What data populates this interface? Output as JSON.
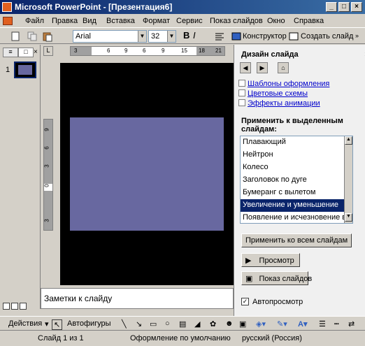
{
  "window": {
    "title": "Microsoft PowerPoint - [Презентация6]"
  },
  "menu": [
    "Файл",
    "Правка",
    "Вид",
    "Вставка",
    "Формат",
    "Сервис",
    "Показ слайдов",
    "Окно",
    "Справка"
  ],
  "toolbar": {
    "font": "Arial",
    "size": "32",
    "constructor": "Конструктор",
    "new_slide": "Создать слайд"
  },
  "outline": {
    "slide_number": "1"
  },
  "ruler": {
    "ticks": [
      "3",
      "6",
      "9",
      "6",
      "9",
      "15",
      "18",
      "21"
    ]
  },
  "vruler": {
    "ticks": [
      "9",
      "6",
      "3",
      "0",
      "3"
    ]
  },
  "notes": {
    "placeholder": "Заметки к слайду"
  },
  "taskpane": {
    "title": "Дизайн слайда",
    "links": [
      "Шаблоны оформления",
      "Цветовые схемы",
      "Эффекты анимации"
    ],
    "apply_label": "Применить к выделенным слайдам:",
    "effects": [
      "Плавающий",
      "Нейтрон",
      "Колесо",
      "Заголовок по дуге",
      "Бумеранг с вылетом",
      "Увеличение и уменьшение",
      "Появление и исчезновение в ..."
    ],
    "selected_index": 5,
    "apply_all": "Применить ко всем слайдам",
    "preview": "Просмотр",
    "slideshow": "Показ слайдов",
    "autopreview": "Автопросмотр"
  },
  "drawbar": {
    "actions": "Действия",
    "autoshapes": "Автофигуры"
  },
  "status": {
    "slide": "Слайд 1 из 1",
    "design": "Оформление по умолчанию",
    "language": "русский (Россия)"
  },
  "colors": {
    "titlebar": "#0a246a",
    "slide_fill": "#6868a0",
    "selection": "#0a246a"
  }
}
